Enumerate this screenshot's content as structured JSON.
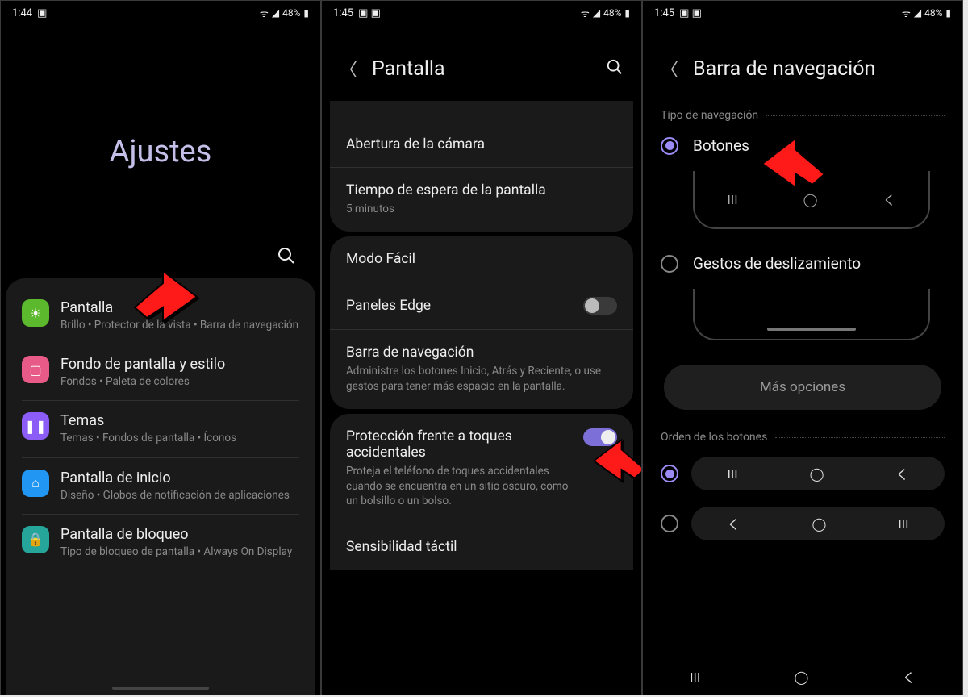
{
  "panel1": {
    "status": {
      "time": "1:44",
      "battery": "48%"
    },
    "title": "Ajustes",
    "items": [
      {
        "title": "Pantalla",
        "sub": "Brillo • Protector de la vista • Barra de navegación",
        "ico": "green",
        "glyph": "☀"
      },
      {
        "title": "Fondo de pantalla y estilo",
        "sub": "Fondos • Paleta de colores",
        "ico": "pink",
        "glyph": "▢"
      },
      {
        "title": "Temas",
        "sub": "Temas • Fondos de pantalla • Íconos",
        "ico": "purple",
        "glyph": "❚❚"
      },
      {
        "title": "Pantalla de inicio",
        "sub": "Diseño • Globos de notificación de aplicaciones",
        "ico": "blue",
        "glyph": "⌂"
      },
      {
        "title": "Pantalla de bloqueo",
        "sub": "Tipo de bloqueo de pantalla • Always On Display",
        "ico": "teal",
        "glyph": "🔒"
      }
    ]
  },
  "panel2": {
    "status": {
      "time": "1:45",
      "battery": "48%"
    },
    "title": "Pantalla",
    "cardA": [
      {
        "title": "Abertura de la cámara"
      },
      {
        "title": "Tiempo de espera de la pantalla",
        "sub": "5 minutos"
      }
    ],
    "cardB": [
      {
        "title": "Modo Fácil"
      },
      {
        "title": "Paneles Edge",
        "toggle": "off"
      },
      {
        "title": "Barra de navegación",
        "sub": "Administre los botones Inicio, Atrás y Reciente, o use gestos para tener más espacio en la pantalla."
      }
    ],
    "cardC": [
      {
        "title": "Protección frente a toques accidentales",
        "sub": "Proteja el teléfono de toques accidentales cuando se encuentra en un sitio oscuro, como un bolsillo o un bolso.",
        "toggle": "on"
      },
      {
        "title": "Sensibilidad táctil"
      }
    ]
  },
  "panel3": {
    "status": {
      "time": "1:45",
      "battery": "48%"
    },
    "title": "Barra de navegación",
    "section1": "Tipo de navegación",
    "opt1": "Botones",
    "opt2": "Gestos de deslizamiento",
    "more": "Más opciones",
    "section2": "Orden de los botones",
    "navGlyphs": {
      "recents": "III",
      "home": "◯",
      "back": "く"
    }
  },
  "signalGlyphs": {
    "wifi": "▾",
    "signal": "▮◢",
    "batt": "▮"
  }
}
